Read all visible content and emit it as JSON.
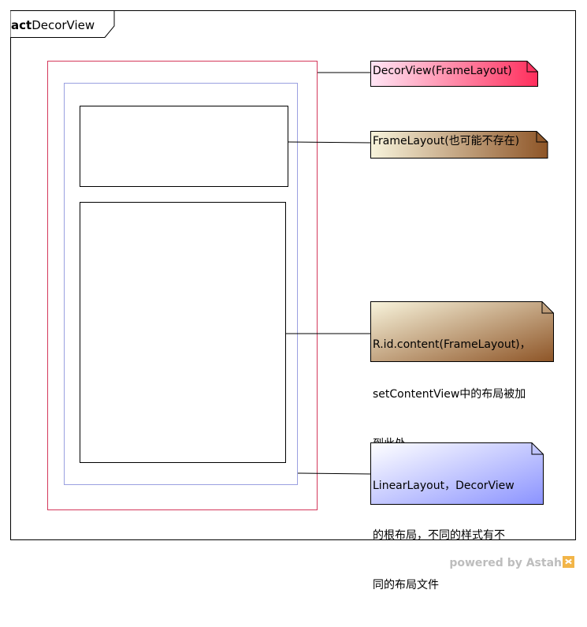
{
  "diagram": {
    "frame_keyword": "act",
    "frame_name": "DecorView"
  },
  "notes": [
    {
      "id": "decorview",
      "lines": [
        "DecorView(FrameLayout)"
      ],
      "gradient_from": "#ffe6f5",
      "gradient_to": "#ff2e5c"
    },
    {
      "id": "titlebar",
      "lines": [
        "FrameLayout(也可能不存在)"
      ],
      "gradient_from": "#f8f4dc",
      "gradient_to": "#8e5527"
    },
    {
      "id": "content",
      "lines": [
        "R.id.content(FrameLayout)，",
        "setContentView中的布局被加",
        "到此处"
      ],
      "gradient_from": "#f8f4dc",
      "gradient_to": "#8e5527"
    },
    {
      "id": "linearlayout",
      "lines": [
        "LinearLayout，DecorView",
        "的根布局，不同的样式有不",
        "同的布局文件"
      ],
      "gradient_from": "#ffffff",
      "gradient_to": "#8b93ff"
    }
  ],
  "colors": {
    "decor_border": "#d4385b",
    "linear_border": "#9aa0e0"
  },
  "watermark": {
    "text": "powered by Astah"
  }
}
